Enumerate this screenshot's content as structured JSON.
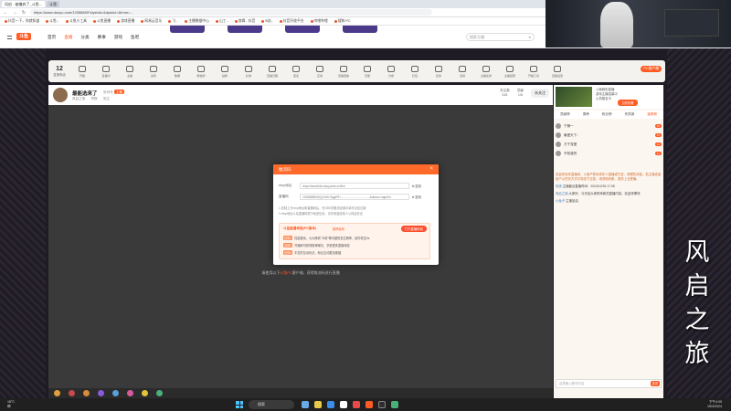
{
  "browser": {
    "tabs": [
      "风启 - 被嫌弃了_斗鱼...",
      "斗鱼"
    ],
    "url": "https://www.douyu.com/12058859?dyshid=&dyshci=&from=...",
    "bookmarks": [
      "抖音一下，你就知道",
      "斗鱼...",
      "斗鱼小工具",
      "斗鱼直播",
      "游戏直播",
      "网易云音乐",
      "飞...",
      "主播数据中心",
      "山丁..",
      "剪辑 - 抖音",
      "B站..",
      "抖音开放平台",
      "哔哩哔哩",
      "搜狗 PC",
      "首页 - 抖音",
      "通迅天..."
    ]
  },
  "site": {
    "logo": "斗鱼",
    "nav": [
      "首页",
      "直播",
      "分类",
      "赛事",
      "游戏",
      "鱼吧"
    ],
    "search_placeholder": "搜索主播",
    "search_btn": "搜索"
  },
  "categories": {
    "level": "12",
    "level_label": "直播等级",
    "items": [
      "开播",
      "直播间",
      "主播",
      "房管",
      "数据",
      "粉丝牌",
      "钻粉",
      "礼物",
      "直播日程",
      "连麦",
      "互动",
      "直播回放",
      "高能",
      "分成",
      "红包",
      "任务",
      "活动",
      "主播任务",
      "主播招募",
      "开播工具",
      "直播设置",
      "道具",
      "主播商城",
      "排行",
      "签到"
    ],
    "pc_client": "PC客户端"
  },
  "room": {
    "title": "最能选来了",
    "id": "房间号",
    "anchor_badge": "主播",
    "sub": [
      "风启之旅",
      "举报",
      "关注"
    ],
    "stats": [
      {
        "label": "关注数",
        "value": "518"
      },
      {
        "label": "贡献",
        "value": "1/8"
      }
    ],
    "follow": "未关注"
  },
  "player": {
    "hint_prefix": "请使用以下",
    "hint_link": "斗鱼PC",
    "hint_suffix": "客户端，获得推流码进行直播"
  },
  "modal": {
    "title": "推流码",
    "close": "×",
    "rtmp_label": "rtmp地址",
    "rtmp_value": "rtmp://sendtc3a.douyucdn.cn/live",
    "key_label": "直播码",
    "key_value": "12058859rDiQy7eDr7&gyRF=...................................&dwcno=agnXnr",
    "copy": "复制",
    "note1": "1.复制上方rtmp地址和直播码后，在OBS的推流设置中填写对应位置",
    "note2": "2.rtmp地址以及直播码属于私密信息，请勿泄露给他人以保证安全",
    "promo_title": "斗鱼直播伴侣(PC版本)",
    "promo_tag": "推荐使用",
    "promo_btn": "打开直播伴侣",
    "promo_lines": [
      {
        "tag": "优势1",
        "text": "性能更优，大大降低\"卡顿\"等问题的发生概率，延时低至3s"
      },
      {
        "tag": "优势2",
        "text": "开播即可获得推荐曝光，享受更多直播特权"
      },
      {
        "tag": "优势3",
        "text": "丰富的互动玩法，粉丝互动更加便捷"
      }
    ]
  },
  "right_panel": {
    "ad_text": [
      "斗鱼精彩直播",
      "游戏主播招募中",
      "火热报名中"
    ],
    "ad_btn": "立即查看",
    "tabs": [
      "贡献榜",
      "周榜",
      "粉丝榜",
      "贵宾席",
      "道具榜"
    ],
    "ranks": [
      {
        "name": "宁静一",
        "badge": "18"
      },
      {
        "name": "最爱天下..",
        "badge": "16"
      },
      {
        "name": "万千宠爱",
        "badge": "14"
      },
      {
        "name": "不知道的",
        "badge": "12"
      }
    ],
    "chat": [
      {
        "nick": "",
        "text": "欢迎来到本直播间，斗鱼严禁未成年人直播或打赏，请理性消费。若主播或者用户以任何方式引导线下交易，请谨慎判断，谨防上当受骗。",
        "dark": false
      },
      {
        "nick": "系统:",
        "text": "主播最近直播时间：2024/12/26 17:08",
        "dark": true
      },
      {
        "nick": "风启之旅:",
        "text": "大家好，今天给大家带来新的直播内容，欢迎来捧场",
        "dark": true
      },
      {
        "nick": "小兔子:",
        "text": "主播加油",
        "dark": true
      }
    ],
    "chat_placeholder": "这里输入聊天内容",
    "send": "发送"
  },
  "overlay": [
    "风",
    "启",
    "之",
    "旅"
  ],
  "taskbar": {
    "weather_temp": "18°C",
    "weather_desc": "晴",
    "search": "搜索",
    "time": "下午4:05",
    "date": "15/4/2024"
  }
}
